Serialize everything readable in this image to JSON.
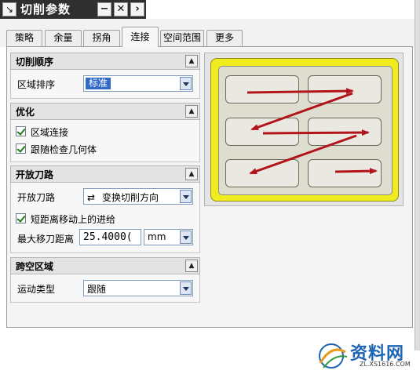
{
  "window": {
    "title": "切削参数",
    "icon": "arrow-icon",
    "minimize_glyph": "−",
    "close_glyph": "✕",
    "scroll_glyph": "›"
  },
  "tabs": [
    {
      "label": "策略",
      "active": false
    },
    {
      "label": "余量",
      "active": false
    },
    {
      "label": "拐角",
      "active": false
    },
    {
      "label": "连接",
      "active": true
    },
    {
      "label": "空间范围",
      "active": false
    },
    {
      "label": "更多",
      "active": false
    }
  ],
  "groups": {
    "cut_order": {
      "title": "切削顺序",
      "collapse_glyph": "▲",
      "region_sort": {
        "label": "区域排序",
        "value": "标准"
      }
    },
    "optimize": {
      "title": "优化",
      "collapse_glyph": "▲",
      "region_connect": {
        "label": "区域连接",
        "checked": true
      },
      "follow_check_geometry": {
        "label": "跟随检查几何体",
        "checked": true
      }
    },
    "open_path": {
      "title": "开放刀路",
      "collapse_glyph": "▲",
      "open_path": {
        "label": "开放刀路",
        "value": "变换切削方向",
        "icon": "swap-direction-icon",
        "icon_glyph": "⇄"
      },
      "short_move": {
        "label": "短距离移动上的进给",
        "checked": true
      },
      "max_transfer": {
        "label": "最大移刀距离",
        "value": "25.4000(",
        "unit": "mm"
      }
    },
    "gap_region": {
      "title": "跨空区域",
      "collapse_glyph": "▲",
      "motion_type": {
        "label": "运动类型",
        "value": "跟随"
      }
    }
  },
  "preview": {
    "colors": {
      "frame": "#f0ec1f",
      "arrow": "#b3141a",
      "cell": "#e9e9e2"
    }
  },
  "watermark": {
    "name": "资料网",
    "url": "ZL.XS1616.COM"
  }
}
